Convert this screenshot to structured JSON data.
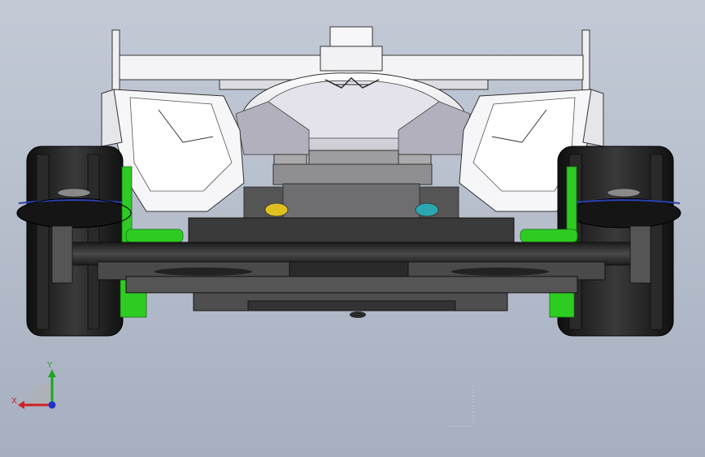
{
  "viewport": {
    "background_top": "#c3cad6",
    "background_bottom": "#a6afbf",
    "view": "front"
  },
  "model": {
    "name": "",
    "body_color": "#f4f4f8",
    "shadow_color": "#9a98a6",
    "chassis_color": "#3b3b3b",
    "tire_color": "#1c1c1c",
    "accent_green": "#2ecc23",
    "accent_blue": "#2a3fae"
  },
  "triad": {
    "x_label": "X",
    "y_label": "Y",
    "x_color": "#d22020",
    "y_color": "#1fa51f",
    "z_color": "#2030c8"
  }
}
